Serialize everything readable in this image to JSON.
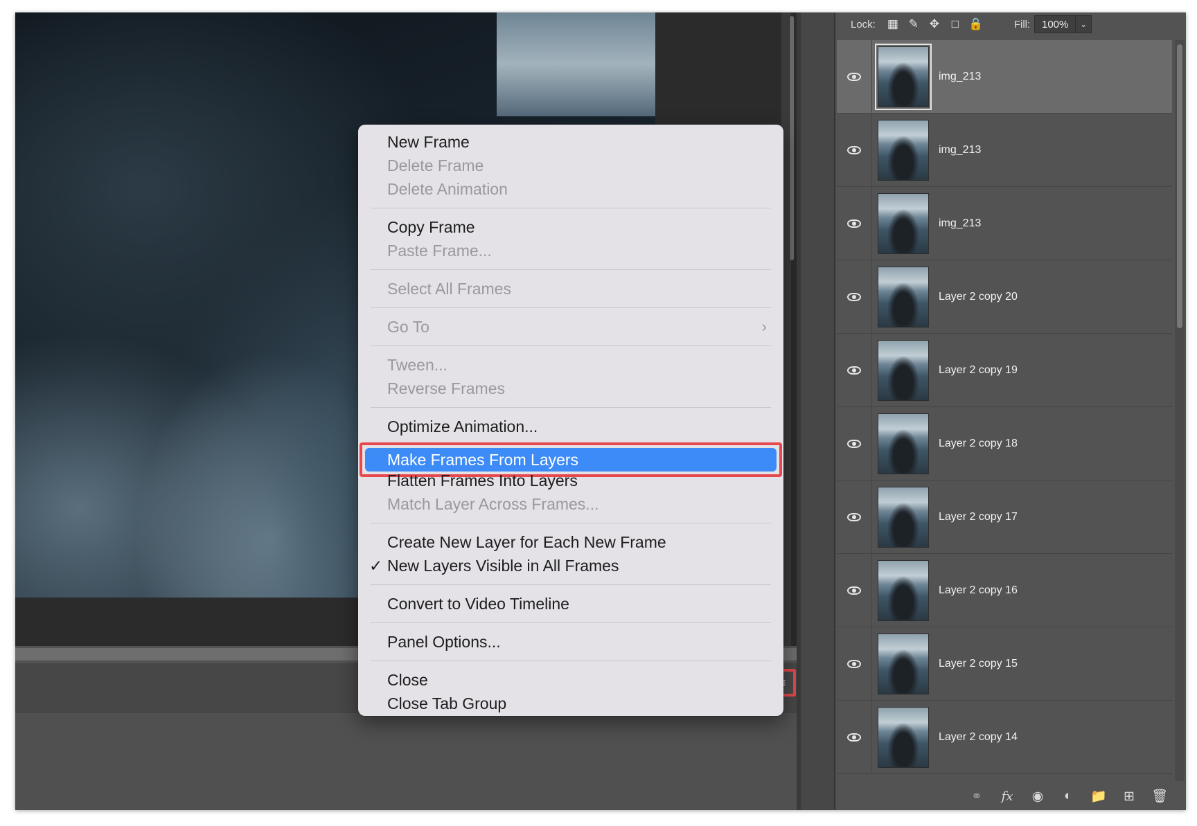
{
  "layers_panel": {
    "lock_label": "Lock:",
    "lock_icons": [
      "lock-transparent-pixels-icon",
      "lock-image-pixels-icon",
      "lock-position-icon",
      "lock-artboard-icon",
      "lock-all-icon"
    ],
    "fill_label": "Fill:",
    "fill_value": "100%",
    "layers": [
      {
        "name": "img_213",
        "visible": true,
        "selected": true
      },
      {
        "name": "img_213",
        "visible": true,
        "selected": false
      },
      {
        "name": "img_213",
        "visible": true,
        "selected": false
      },
      {
        "name": "Layer 2 copy 20",
        "visible": true,
        "selected": false
      },
      {
        "name": "Layer 2 copy 19",
        "visible": true,
        "selected": false
      },
      {
        "name": "Layer 2 copy 18",
        "visible": true,
        "selected": false
      },
      {
        "name": "Layer 2 copy 17",
        "visible": true,
        "selected": false
      },
      {
        "name": "Layer 2 copy 16",
        "visible": true,
        "selected": false
      },
      {
        "name": "Layer 2 copy 15",
        "visible": true,
        "selected": false
      },
      {
        "name": "Layer 2 copy 14",
        "visible": true,
        "selected": false
      }
    ],
    "footer_icons": [
      "link-layers-icon",
      "fx-icon",
      "add-mask-icon",
      "adjustment-layer-icon",
      "new-group-icon",
      "new-layer-icon",
      "delete-layer-icon"
    ]
  },
  "context_menu": {
    "items": {
      "new_frame": "New Frame",
      "delete_frame": "Delete Frame",
      "delete_animation": "Delete Animation",
      "copy_frame": "Copy Frame",
      "paste_frame": "Paste Frame...",
      "select_all_frames": "Select All Frames",
      "go_to": "Go To",
      "tween": "Tween...",
      "reverse_frames": "Reverse Frames",
      "optimize_animation": "Optimize Animation...",
      "make_frames_from_layers": "Make Frames From Layers",
      "flatten_frames": "Flatten Frames Into Layers",
      "match_layer": "Match Layer Across Frames...",
      "create_new_layer": "Create New Layer for Each New Frame",
      "new_layers_visible": "New Layers Visible in All Frames",
      "convert_video": "Convert to Video Timeline",
      "panel_options": "Panel Options...",
      "close": "Close",
      "close_tab_group": "Close Tab Group"
    }
  },
  "colors": {
    "highlight": "#3d8bf7",
    "annotation": "#e5484d"
  }
}
